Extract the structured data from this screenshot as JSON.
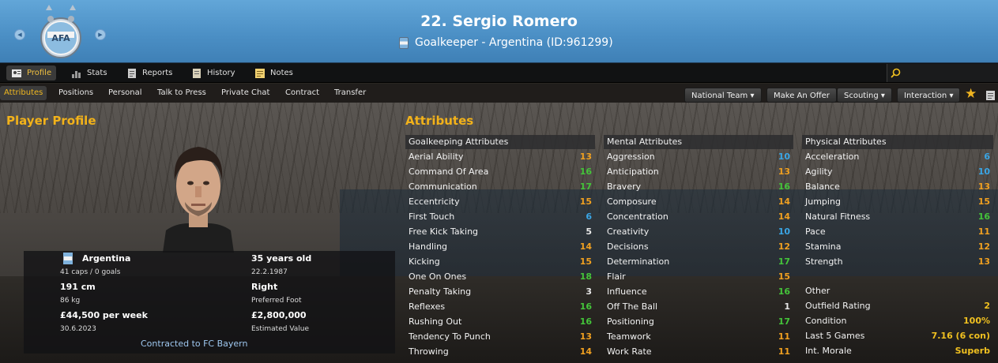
{
  "header": {
    "title": "22. Sergio Romero",
    "subtitle": "Goalkeeper - Argentina (ID:961299)"
  },
  "tabs": [
    {
      "label": "Profile",
      "icon": "profile-icon",
      "active": true
    },
    {
      "label": "Stats",
      "icon": "stats-icon"
    },
    {
      "label": "Reports",
      "icon": "reports-icon"
    },
    {
      "label": "History",
      "icon": "history-icon"
    },
    {
      "label": "Notes",
      "icon": "notes-icon"
    }
  ],
  "subtabs": [
    "Attributes",
    "Positions",
    "Personal",
    "Talk to Press",
    "Private Chat",
    "Contract",
    "Transfer"
  ],
  "actions": {
    "national_team": "National Team",
    "make_offer": "Make An Offer",
    "scouting": "Scouting",
    "interaction": "Interaction"
  },
  "profile": {
    "section_title": "Player Profile",
    "nation": "Argentina",
    "caps": "41 caps / 0 goals",
    "height": "191 cm",
    "weight": "86 kg",
    "wage": "£44,500 per week",
    "contract_end": "30.6.2023",
    "age": "35 years old",
    "dob": "22.2.1987",
    "foot": "Right",
    "foot_label": "Preferred Foot",
    "value": "£2,800,000",
    "value_label": "Estimated Value",
    "contracted": "Contracted to FC Bayern"
  },
  "attributes": {
    "section_title": "Attributes",
    "goalkeeping": {
      "title": "Goalkeeping Attributes",
      "rows": [
        {
          "name": "Aerial Ability",
          "value": "13",
          "color": "orange"
        },
        {
          "name": "Command Of Area",
          "value": "16",
          "color": "green"
        },
        {
          "name": "Communication",
          "value": "17",
          "color": "green"
        },
        {
          "name": "Eccentricity",
          "value": "15",
          "color": "orange"
        },
        {
          "name": "First Touch",
          "value": "6",
          "color": "blue"
        },
        {
          "name": "Free Kick Taking",
          "value": "5",
          "color": "white"
        },
        {
          "name": "Handling",
          "value": "14",
          "color": "orange"
        },
        {
          "name": "Kicking",
          "value": "15",
          "color": "orange"
        },
        {
          "name": "One On Ones",
          "value": "18",
          "color": "green"
        },
        {
          "name": "Penalty Taking",
          "value": "3",
          "color": "white"
        },
        {
          "name": "Reflexes",
          "value": "16",
          "color": "green"
        },
        {
          "name": "Rushing Out",
          "value": "16",
          "color": "green"
        },
        {
          "name": "Tendency To Punch",
          "value": "13",
          "color": "orange"
        },
        {
          "name": "Throwing",
          "value": "14",
          "color": "orange"
        }
      ]
    },
    "mental": {
      "title": "Mental Attributes",
      "rows": [
        {
          "name": "Aggression",
          "value": "10",
          "color": "blue"
        },
        {
          "name": "Anticipation",
          "value": "13",
          "color": "orange"
        },
        {
          "name": "Bravery",
          "value": "16",
          "color": "green"
        },
        {
          "name": "Composure",
          "value": "14",
          "color": "orange"
        },
        {
          "name": "Concentration",
          "value": "14",
          "color": "orange"
        },
        {
          "name": "Creativity",
          "value": "10",
          "color": "blue"
        },
        {
          "name": "Decisions",
          "value": "12",
          "color": "orange"
        },
        {
          "name": "Determination",
          "value": "17",
          "color": "green"
        },
        {
          "name": "Flair",
          "value": "15",
          "color": "orange"
        },
        {
          "name": "Influence",
          "value": "16",
          "color": "green"
        },
        {
          "name": "Off The Ball",
          "value": "1",
          "color": "white"
        },
        {
          "name": "Positioning",
          "value": "17",
          "color": "green"
        },
        {
          "name": "Teamwork",
          "value": "11",
          "color": "orange"
        },
        {
          "name": "Work Rate",
          "value": "11",
          "color": "orange"
        }
      ]
    },
    "physical": {
      "title": "Physical Attributes",
      "rows": [
        {
          "name": "Acceleration",
          "value": "6",
          "color": "blue"
        },
        {
          "name": "Agility",
          "value": "10",
          "color": "blue"
        },
        {
          "name": "Balance",
          "value": "13",
          "color": "orange"
        },
        {
          "name": "Jumping",
          "value": "15",
          "color": "orange"
        },
        {
          "name": "Natural Fitness",
          "value": "16",
          "color": "green"
        },
        {
          "name": "Pace",
          "value": "11",
          "color": "orange"
        },
        {
          "name": "Stamina",
          "value": "12",
          "color": "orange"
        },
        {
          "name": "Strength",
          "value": "13",
          "color": "orange"
        }
      ]
    },
    "other": {
      "title": "Other",
      "rows": [
        {
          "name": "Outfield Rating",
          "value": "2",
          "color": "yellow"
        },
        {
          "name": "Condition",
          "value": "100%",
          "color": "yellow"
        },
        {
          "name": "Last 5 Games",
          "value": "7.16 (6 con)",
          "color": "yellow"
        },
        {
          "name": "Int. Morale",
          "value": "Superb",
          "color": "yellow"
        }
      ]
    }
  }
}
